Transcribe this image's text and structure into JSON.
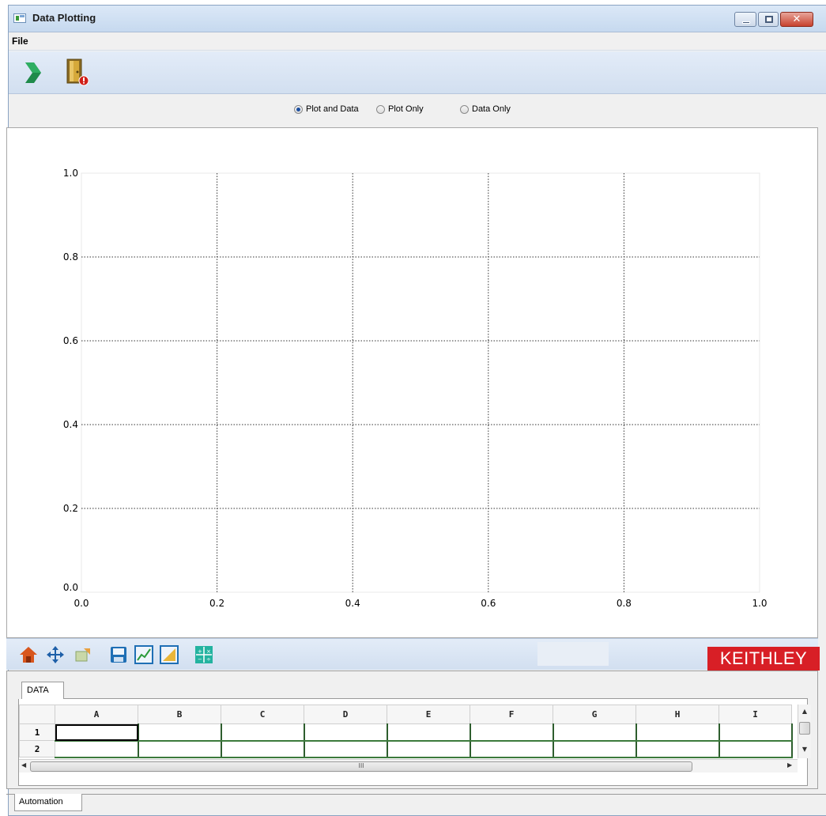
{
  "window": {
    "title": "Data Plotting",
    "buttons": {
      "minimize": "minimize",
      "maximize": "maximize",
      "close": "✕"
    }
  },
  "menu": {
    "file_label": "File"
  },
  "toolbar": {
    "run_icon": "run-arrow-icon",
    "exit_icon": "exit-door-icon"
  },
  "view_options": [
    {
      "label": "Plot and Data",
      "selected": true
    },
    {
      "label": "Plot Only",
      "selected": false
    },
    {
      "label": "Data Only",
      "selected": false
    }
  ],
  "chart_data": {
    "type": "line",
    "title": "",
    "xlabel": "",
    "ylabel": "",
    "xlim": [
      0.0,
      1.0
    ],
    "ylim": [
      0.0,
      1.0
    ],
    "xticks": [
      "0.0",
      "0.2",
      "0.4",
      "0.6",
      "0.8",
      "1.0"
    ],
    "yticks": [
      "0.0",
      "0.2",
      "0.4",
      "0.6",
      "0.8",
      "1.0"
    ],
    "grid": true,
    "series": []
  },
  "nav_toolbar": {
    "icons": [
      "home-icon",
      "pan-icon",
      "zoom-icon",
      "save-icon",
      "plot-config-icon",
      "subplot-icon",
      "grid-icon"
    ],
    "brand": "KEITHLEY",
    "brand_color": "#d81f26"
  },
  "data_panel": {
    "tab_label": "DATA",
    "columns": [
      "A",
      "B",
      "C",
      "D",
      "E",
      "F",
      "G",
      "H",
      "I"
    ],
    "rows": [
      "1",
      "2"
    ],
    "scroll_grip": "III"
  },
  "bottom_tabs": {
    "automation_label": "Automation"
  }
}
